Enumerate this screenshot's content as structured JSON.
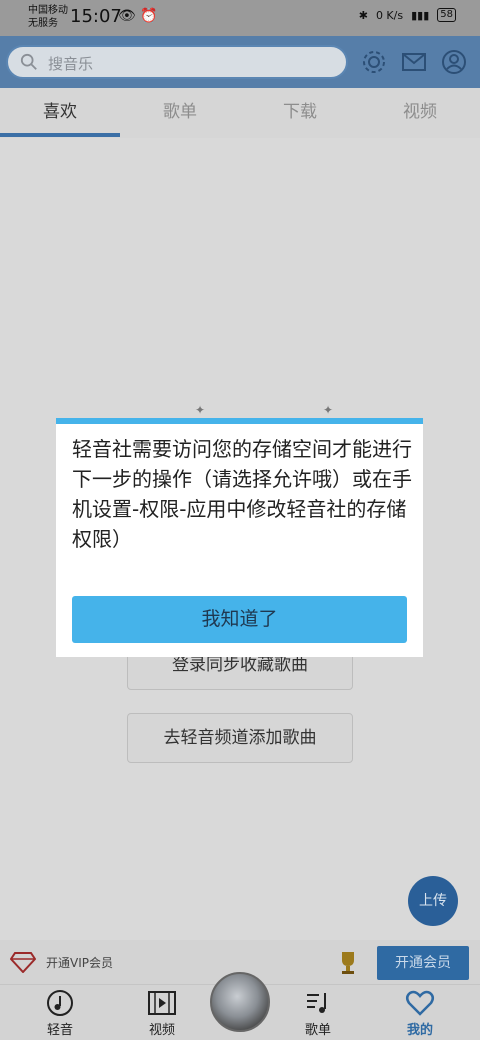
{
  "status_bar": {
    "carrier_line1": "中国移动",
    "carrier_line2": "无服务",
    "time": "15:07",
    "left_icons": "👁 ⏰",
    "net_speed": "0 K/s",
    "battery": "58"
  },
  "header": {
    "search_placeholder": "搜音乐"
  },
  "tabs": [
    {
      "label": "喜欢",
      "active": true
    },
    {
      "label": "歌单",
      "active": false
    },
    {
      "label": "下载",
      "active": false
    },
    {
      "label": "视频",
      "active": false
    }
  ],
  "content": {
    "login_sync_label": "登录同步收藏歌曲",
    "add_songs_label": "去轻音频道添加歌曲"
  },
  "upload_label": "上传",
  "vip_bar": {
    "promo_text": "开通VIP会员",
    "button_label": "开通会员"
  },
  "bottom_nav": [
    {
      "label": "轻音",
      "icon": "music-note-icon",
      "active": false
    },
    {
      "label": "视频",
      "icon": "film-icon",
      "active": false
    },
    {
      "label": "歌单",
      "icon": "playlist-icon",
      "active": false
    },
    {
      "label": "我的",
      "icon": "heart-icon",
      "active": true
    }
  ],
  "dialog": {
    "message": "轻音社需要访问您的存储空间才能进行下一步的操作（请选择允许哦）或在手机设置-权限-应用中修改轻音社的存储权限）",
    "confirm_label": "我知道了"
  },
  "colors": {
    "header_blue": "#567ea9",
    "accent_blue": "#45b3ea",
    "active_tab_underline": "#3b6fa6"
  }
}
